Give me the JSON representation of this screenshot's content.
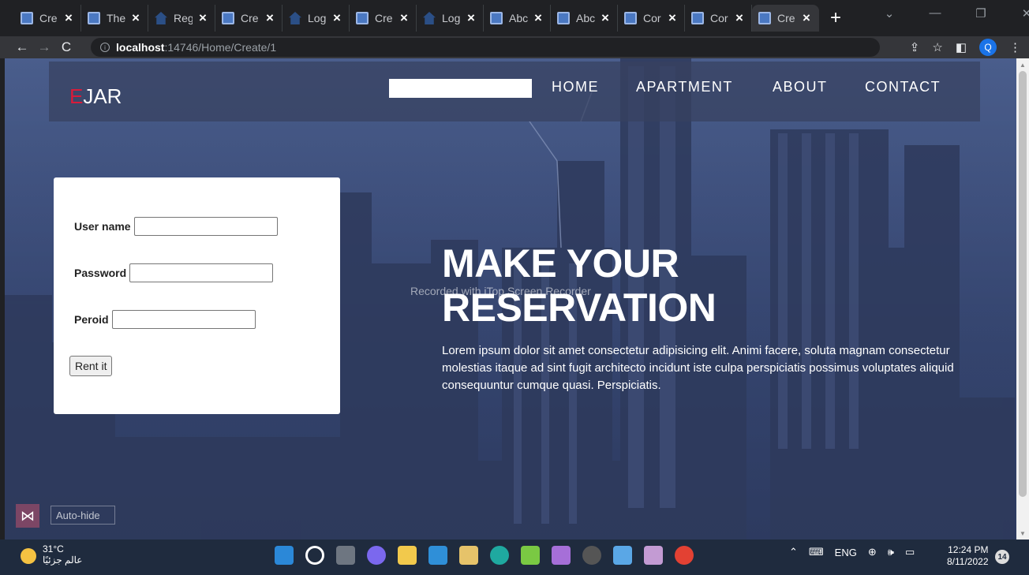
{
  "browser": {
    "tabs": [
      {
        "title": "Cre",
        "icon": "doc-icon",
        "active": false
      },
      {
        "title": "The",
        "icon": "doc-icon",
        "active": false
      },
      {
        "title": "Reg",
        "icon": "home-icon",
        "active": false
      },
      {
        "title": "Cre",
        "icon": "doc-icon",
        "active": false
      },
      {
        "title": "Log",
        "icon": "home-icon",
        "active": false
      },
      {
        "title": "Cre",
        "icon": "doc-icon",
        "active": false
      },
      {
        "title": "Log",
        "icon": "home-icon",
        "active": false
      },
      {
        "title": "Abc",
        "icon": "doc-icon",
        "active": false
      },
      {
        "title": "Abc",
        "icon": "doc-icon",
        "active": false
      },
      {
        "title": "Cor",
        "icon": "doc-icon",
        "active": false
      },
      {
        "title": "Cor",
        "icon": "doc-icon",
        "active": false
      },
      {
        "title": "Cre",
        "icon": "doc-icon",
        "active": true
      }
    ],
    "url_host": "localhost",
    "url_path": ":14746/Home/Create/1",
    "profile_initial": "Q"
  },
  "site": {
    "brand_first": "E",
    "brand_rest": "JAR",
    "brand_accent": "#d81b3a",
    "menu": [
      "HOME",
      "APARTMENT",
      "ABOUT",
      "CONTACT"
    ]
  },
  "form": {
    "username_label": "User name",
    "password_label": "Password",
    "period_label": "Peroid",
    "username_value": "",
    "password_value": "",
    "period_value": "",
    "submit_label": "Rent it"
  },
  "hero": {
    "line1": "MAKE YOUR",
    "line2": "RESERVATION",
    "body": "Lorem ipsum dolor sit amet consectetur adipisicing elit. Animi facere, soluta magnam consectetur molestias itaque ad sint fugit architecto incidunt iste culpa perspiciatis possimus voluptates aliquid consequuntur cumque quasi. Perspiciatis.",
    "watermark": "Recorded with iTop Screen Recorder",
    "autohide": "Auto-hide"
  },
  "taskbar": {
    "temperature": "31°C",
    "weather_text": "عالم جزئيًا",
    "language": "ENG",
    "time": "12:24 PM",
    "date": "8/11/2022",
    "notifications": "14"
  }
}
